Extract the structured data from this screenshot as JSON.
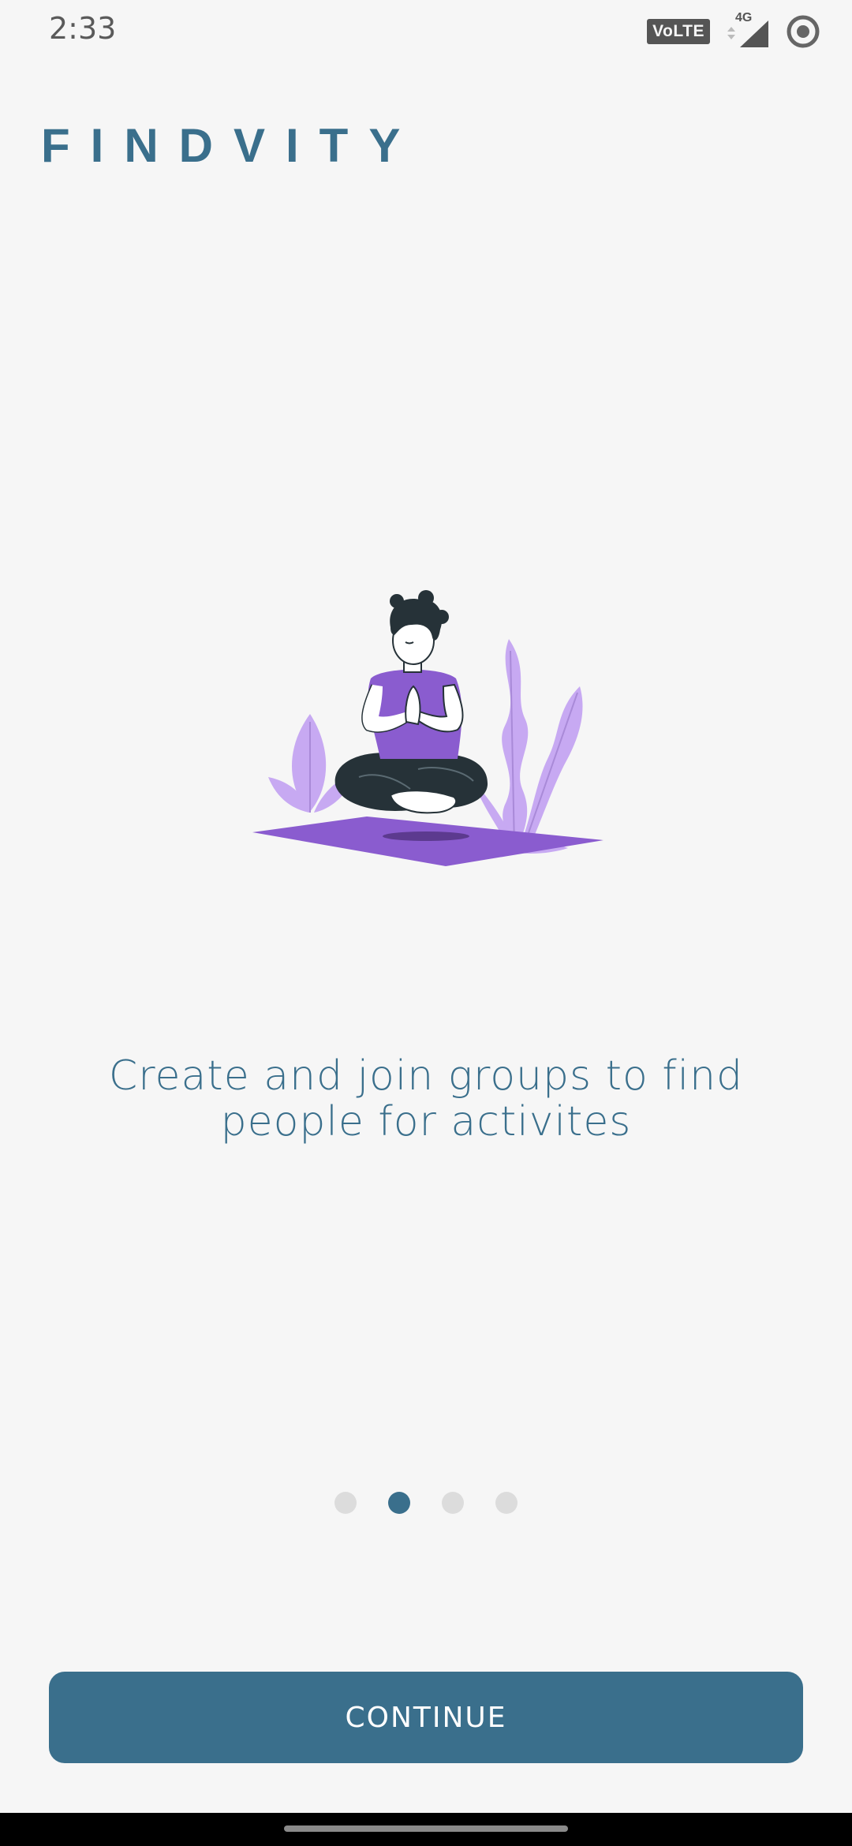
{
  "status_bar": {
    "time": "2:33",
    "volte": "VoLTE",
    "network": "4G"
  },
  "app": {
    "brand": "FINDVITY"
  },
  "onboarding": {
    "caption": "Create and join groups to find people for activites",
    "illustration": "person-meditating-illustration",
    "pager": {
      "count": 4,
      "active_index": 1
    },
    "continue_label": "CONTINUE"
  },
  "colors": {
    "primary": "#3a6f8c",
    "accent_purple": "#8a5ccf",
    "light_purple": "#c7a9f2",
    "background": "#f6f6f6"
  }
}
